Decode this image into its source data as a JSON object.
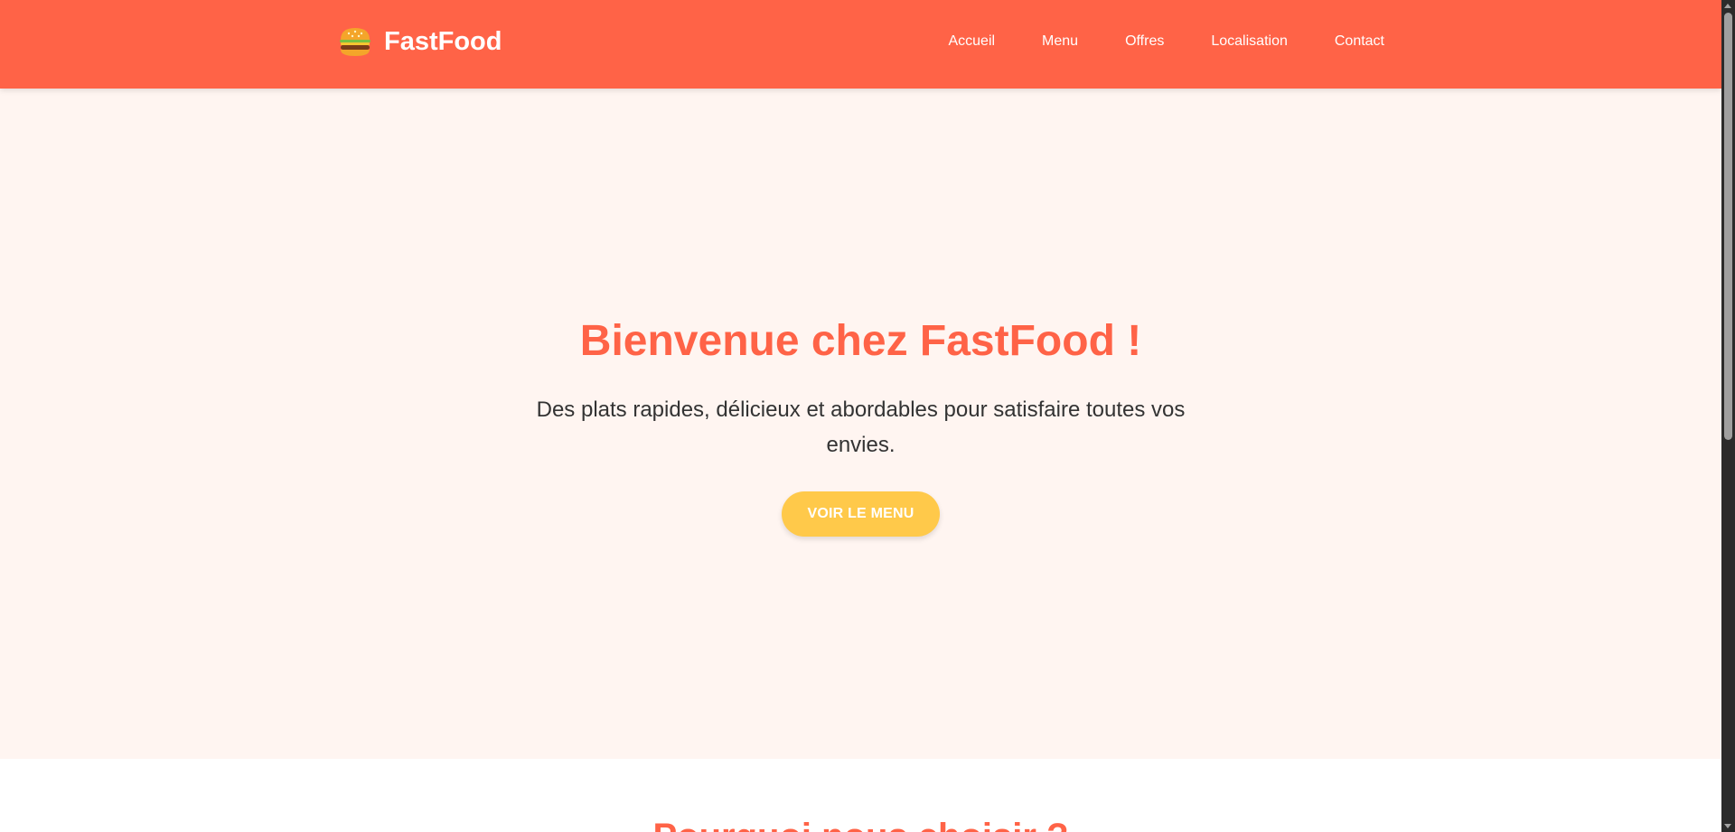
{
  "brand": {
    "name": "FastFood",
    "icon": "burger-icon"
  },
  "nav": {
    "items": [
      {
        "label": "Accueil"
      },
      {
        "label": "Menu"
      },
      {
        "label": "Offres"
      },
      {
        "label": "Localisation"
      },
      {
        "label": "Contact"
      }
    ]
  },
  "hero": {
    "title": "Bienvenue chez FastFood !",
    "subtitle": "Des plats rapides, délicieux et abordables pour satisfaire toutes vos envies.",
    "cta_label": "VOIR LE MENU"
  },
  "next_section": {
    "title": "Pourquoi nous choisir ?"
  },
  "colors": {
    "primary": "#ff6347",
    "hero_background": "#fff5f1",
    "cta": "#ffc94a",
    "text": "#333333"
  }
}
